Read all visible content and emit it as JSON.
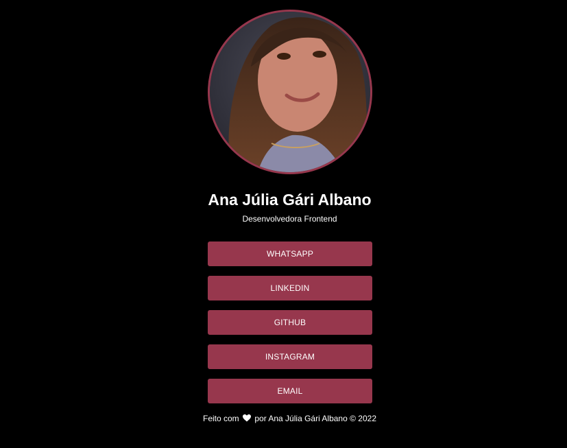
{
  "profile": {
    "name": "Ana Júlia Gári Albano",
    "role": "Desenvolvedora Frontend",
    "avatar_icon": "profile-photo"
  },
  "links": [
    {
      "label": "WHATSAPP"
    },
    {
      "label": "LINKEDIN"
    },
    {
      "label": "GITHUB"
    },
    {
      "label": "INSTAGRAM"
    },
    {
      "label": "EMAIL"
    }
  ],
  "footer": {
    "prefix": "Feito com",
    "heart_icon": "heart-icon",
    "suffix": "por Ana Júlia Gári Albano © 2022"
  },
  "colors": {
    "background": "#000000",
    "accent": "#97374d",
    "text": "#ffffff"
  }
}
